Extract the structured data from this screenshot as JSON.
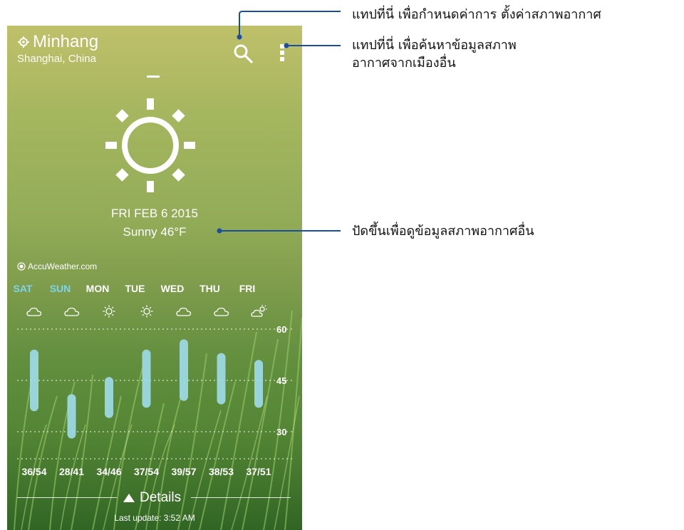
{
  "header": {
    "city": "Minhang",
    "region": "Shanghai, China"
  },
  "current": {
    "date": "FRI FEB 6 2015",
    "condition": "Sunny 46°F",
    "icon": "sun-icon"
  },
  "provider": "AccuWeather.com",
  "forecast": {
    "days": [
      {
        "label": "SAT",
        "weekend": true,
        "icon": "cloud-icon",
        "low": 36,
        "high": 54,
        "range": "36/54"
      },
      {
        "label": "SUN",
        "weekend": true,
        "icon": "cloud-icon",
        "low": 28,
        "high": 41,
        "range": "28/41"
      },
      {
        "label": "MON",
        "weekend": false,
        "icon": "sun-icon",
        "low": 34,
        "high": 46,
        "range": "34/46"
      },
      {
        "label": "TUE",
        "weekend": false,
        "icon": "sun-icon",
        "low": 37,
        "high": 54,
        "range": "37/54"
      },
      {
        "label": "WED",
        "weekend": false,
        "icon": "cloud-icon",
        "low": 39,
        "high": 57,
        "range": "39/57"
      },
      {
        "label": "THU",
        "weekend": false,
        "icon": "cloud-icon",
        "low": 38,
        "high": 53,
        "range": "38/53"
      },
      {
        "label": "FRI",
        "weekend": false,
        "icon": "partly-cloudy-icon",
        "low": 37,
        "high": 51,
        "range": "37/51"
      }
    ],
    "axis_ticks": [
      "60",
      "45",
      "30"
    ]
  },
  "chart_data": {
    "type": "bar",
    "categories": [
      "SAT",
      "SUN",
      "MON",
      "TUE",
      "WED",
      "THU",
      "FRI"
    ],
    "series": [
      {
        "values_low": [
          36,
          28,
          34,
          37,
          39,
          38,
          37
        ],
        "values_high": [
          54,
          41,
          46,
          54,
          57,
          53,
          51
        ]
      }
    ],
    "yticks": [
      60,
      45,
      30
    ],
    "grid": true
  },
  "footer": {
    "details_label": "Details",
    "last_update": "Last update: 3:52 AM"
  },
  "callouts": {
    "settings": "แทปที่นี่ เพื่อกำหนดค่าการ ตั้งค่าสภาพอากาศ",
    "search_line1": "แทปที่นี่ เพื่อค้นหาข้อมูลสภาพ",
    "search_line2": "อากาศจากเมืองอื่น",
    "swipe": "ปัดขึ้นเพื่อดูข้อมูลสภาพอากาศอื่น"
  },
  "colors": {
    "weekend": "#7fd4ec",
    "bar": "#9fdcea",
    "callout_line": "#1b4f9c"
  }
}
